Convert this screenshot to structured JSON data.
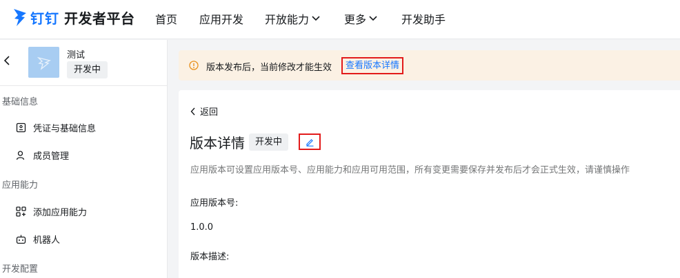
{
  "header": {
    "brand": "钉钉",
    "platform": "开发者平台",
    "nav": [
      {
        "label": "首页"
      },
      {
        "label": "应用开发"
      },
      {
        "label": "开放能力"
      },
      {
        "label": "更多"
      },
      {
        "label": "开发助手"
      }
    ]
  },
  "sidebar": {
    "app": {
      "name": "测试",
      "status": "开发中"
    },
    "groups": [
      {
        "label": "基础信息",
        "items": [
          {
            "label": "凭证与基础信息"
          },
          {
            "label": "成员管理"
          }
        ]
      },
      {
        "label": "应用能力",
        "items": [
          {
            "label": "添加应用能力"
          },
          {
            "label": "机器人"
          }
        ]
      },
      {
        "label": "开发配置",
        "items": []
      }
    ]
  },
  "notice": {
    "text": "版本发布后，当前修改才能生效",
    "link": "查看版本详情"
  },
  "detail": {
    "back_label": "返回",
    "title": "版本详情",
    "status": "开发中",
    "description": "应用版本可设置应用版本号、应用能力和应用可用范围，所有变更需要保存并发布后才会正式生效，请谨慎操作",
    "version_label": "应用版本号:",
    "version_value": "1.0.0",
    "desc_label": "版本描述:"
  },
  "colors": {
    "brand": "#1677ff",
    "notice_bg": "#fbf1e4",
    "notice_icon": "#e8901c",
    "highlight_border": "#e21a1a"
  }
}
